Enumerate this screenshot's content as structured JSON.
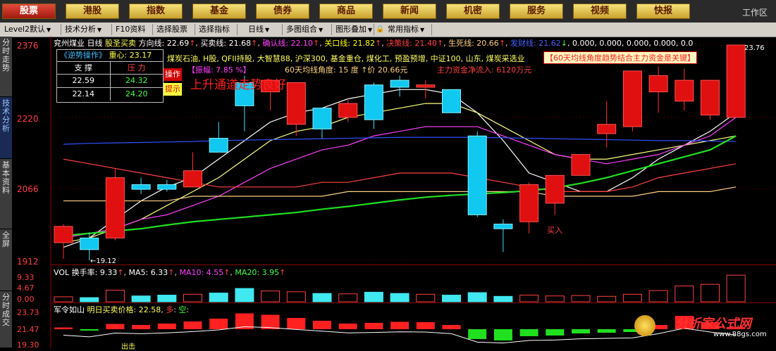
{
  "nav": {
    "buttons": [
      "股票",
      "港股",
      "指数",
      "基金",
      "债券",
      "商品",
      "新闻",
      "机密",
      "服务",
      "视频",
      "快报"
    ],
    "workzone": "工作区"
  },
  "toolbar": {
    "items": [
      "Level2默认",
      "技术分析",
      "F10资料",
      "选择股票",
      "选择指标",
      "日线",
      "多图组合",
      "图形叠加",
      "常用指标"
    ]
  },
  "sidebar": {
    "tabs": [
      "分时走势",
      "技术分析",
      "基本资料",
      "全屏",
      "分时成交"
    ]
  },
  "chart_header": {
    "stock_name": "兖州煤业",
    "period": "日线",
    "indicator": "股圣买卖",
    "lines": [
      {
        "label": "方向线: 22.69",
        "arrow": "↑",
        "color": "#ffffff"
      },
      {
        "label": "买卖线: 21.68",
        "arrow": "↑",
        "color": "#ffffff"
      },
      {
        "label": "确认线: 22.10",
        "arrow": "↑",
        "color": "#ff40ff"
      },
      {
        "label": "关口线: 21.82",
        "arrow": "↑",
        "color": "#ffff00"
      },
      {
        "label": "决策线: 21.40",
        "arrow": "↑",
        "color": "#ff4040"
      },
      {
        "label": "生死线: 20.66",
        "arrow": "↑",
        "color": "#ffd080"
      },
      {
        "label": "发财线: 21.62",
        "arrow": "↓",
        "color": "#4060ff"
      }
    ],
    "extra_values": "0.000, 0.000, 0.000, 0.000, 0.0"
  },
  "reversal_table": {
    "title": "《逆势操作》",
    "center_label": "重心: 23.17",
    "headers": [
      "支 撑",
      "压 力"
    ],
    "rows": [
      [
        "22.59",
        "24.32"
      ],
      [
        "22.14",
        "24.20"
      ]
    ]
  },
  "concepts": "煤炭石油, H股, QFII持股, 大智慧88, 沪深300, 基金重仓, 煤化工, 预盈预增, 中证100, 山东, 煤炭采选业",
  "amplitude": "【振幅: 7.85 %】",
  "ma_angle": "60天均线角度: 15 度 ↑价 20.66元",
  "main_fund": "主力资金净流入: 6120万元",
  "notice": "【60天均线角度趋势结合主力资金是关键】",
  "op_button": "操作",
  "tip_button": "提示",
  "trend_comment": "上升通道走势良好",
  "y_labels": [
    "2376",
    "2220",
    "2066",
    "1912"
  ],
  "low_label": "←19.12",
  "high_label": "23.76",
  "buy_label": "买入",
  "vol": {
    "name": "VOL",
    "turnover": "换手率: 9.33",
    "ma5": "MA5: 6.33",
    "ma10": "MA10: 4.55",
    "ma20": "MA20: 3.95",
    "y_labels": [
      "9.33",
      "4.67",
      "0.00"
    ]
  },
  "army": {
    "title": "军令如山",
    "next_price": "明日买卖价格: 22.58",
    "long_label": "多",
    "short_label": "空",
    "y_labels": [
      "23.73",
      "21.47",
      "19.30"
    ],
    "sell_label": "出击"
  },
  "watermark": "分析家公式网",
  "watermark_url": "www.88gs.com",
  "chart_data": {
    "type": "candlestick",
    "title": "兖州煤业 日线",
    "price_range": [
      19.12,
      23.76
    ],
    "candles": [
      {
        "o": 19.5,
        "h": 19.9,
        "l": 19.15,
        "c": 19.85
      },
      {
        "o": 19.6,
        "h": 19.72,
        "l": 19.12,
        "c": 19.35
      },
      {
        "o": 19.6,
        "h": 21.1,
        "l": 19.55,
        "c": 20.9
      },
      {
        "o": 20.75,
        "h": 20.9,
        "l": 20.55,
        "c": 20.65
      },
      {
        "o": 20.75,
        "h": 20.85,
        "l": 20.6,
        "c": 20.65
      },
      {
        "o": 20.7,
        "h": 21.45,
        "l": 20.7,
        "c": 21.05
      },
      {
        "o": 21.75,
        "h": 22.1,
        "l": 21.55,
        "c": 21.45
      },
      {
        "o": 22.95,
        "h": 23.1,
        "l": 21.9,
        "c": 22.45
      },
      {
        "o": 22.75,
        "h": 23.0,
        "l": 22.35,
        "c": 23.0
      },
      {
        "o": 22.05,
        "h": 22.6,
        "l": 21.8,
        "c": 22.95
      },
      {
        "o": 22.4,
        "h": 22.4,
        "l": 21.75,
        "c": 21.95
      },
      {
        "o": 22.2,
        "h": 22.6,
        "l": 22.1,
        "c": 22.5
      },
      {
        "o": 22.9,
        "h": 22.95,
        "l": 21.95,
        "c": 22.15
      },
      {
        "o": 23.0,
        "h": 23.1,
        "l": 22.65,
        "c": 22.85
      },
      {
        "o": 22.85,
        "h": 23.0,
        "l": 22.6,
        "c": 22.9
      },
      {
        "o": 22.8,
        "h": 22.8,
        "l": 22.35,
        "c": 22.3
      },
      {
        "o": 21.8,
        "h": 21.9,
        "l": 20.05,
        "c": 20.1
      },
      {
        "o": 19.9,
        "h": 20.0,
        "l": 19.3,
        "c": 19.8
      },
      {
        "o": 19.95,
        "h": 20.8,
        "l": 19.7,
        "c": 20.75
      },
      {
        "o": 20.35,
        "h": 20.9,
        "l": 20.1,
        "c": 20.95
      },
      {
        "o": 20.95,
        "h": 21.35,
        "l": 20.95,
        "c": 21.4
      },
      {
        "o": 21.85,
        "h": 22.55,
        "l": 21.55,
        "c": 22.05
      },
      {
        "o": 22.0,
        "h": 23.0,
        "l": 21.9,
        "c": 23.2
      },
      {
        "o": 22.75,
        "h": 23.3,
        "l": 22.3,
        "c": 23.1
      },
      {
        "o": 22.55,
        "h": 23.25,
        "l": 22.35,
        "c": 23.0
      },
      {
        "o": 22.25,
        "h": 22.95,
        "l": 22.15,
        "c": 23.0
      },
      {
        "o": 22.2,
        "h": 23.76,
        "l": 22.2,
        "c": 23.76
      }
    ],
    "ma_lines": [
      {
        "name": "方向线",
        "color": "#ffffff",
        "values": [
          19.4,
          19.6,
          20.0,
          20.4,
          20.7,
          20.9,
          21.3,
          21.7,
          22.1,
          22.3,
          22.4,
          22.6,
          22.7,
          22.8,
          22.8,
          22.7,
          22.3,
          21.7,
          21.0,
          20.8,
          20.6,
          20.6,
          20.9,
          21.3,
          21.6,
          21.9,
          22.3
        ]
      },
      {
        "name": "买卖线",
        "color": "#ffff80",
        "values": [
          19.5,
          19.6,
          19.8,
          20.0,
          20.3,
          20.6,
          20.9,
          21.3,
          21.7,
          21.9,
          22.0,
          22.2,
          22.3,
          22.4,
          22.5,
          22.5,
          22.3,
          22.0,
          21.7,
          21.4,
          21.3,
          21.3,
          21.4,
          21.5,
          21.6,
          21.7,
          21.8
        ]
      },
      {
        "name": "确认线",
        "color": "#ff40ff",
        "values": [
          19.6,
          19.7,
          19.8,
          20.0,
          20.1,
          20.3,
          20.5,
          20.8,
          21.1,
          21.3,
          21.5,
          21.6,
          21.8,
          21.9,
          22.0,
          22.0,
          22.0,
          21.8,
          21.6,
          21.4,
          21.3,
          21.2,
          21.3,
          21.4,
          21.6,
          21.8,
          22.2
        ]
      },
      {
        "name": "决策线",
        "color": "#ff4040",
        "values": [
          21.3,
          21.2,
          21.1,
          21.0,
          20.9,
          20.8,
          20.7,
          20.7,
          20.7,
          20.7,
          20.8,
          20.8,
          20.9,
          21.0,
          21.0,
          21.0,
          20.9,
          20.8,
          20.7,
          20.6,
          20.6,
          20.6,
          20.7,
          20.9,
          21.0,
          21.1,
          21.2
        ]
      },
      {
        "name": "生死线",
        "color": "#ffd080",
        "values": [
          20.4,
          20.4,
          20.4,
          20.4,
          20.4,
          20.5,
          20.5,
          20.5,
          20.5,
          20.5,
          20.5,
          20.6,
          20.6,
          20.6,
          20.6,
          20.6,
          20.6,
          20.6,
          20.6,
          20.5,
          20.5,
          20.5,
          20.5,
          20.6,
          20.6,
          20.6,
          20.7
        ]
      },
      {
        "name": "发财线",
        "color": "#3050ff",
        "values": [
          21.62,
          21.64,
          21.65,
          21.66,
          21.67,
          21.68,
          21.7,
          21.71,
          21.72,
          21.73,
          21.74,
          21.75,
          21.76,
          21.77,
          21.77,
          21.77,
          21.77,
          21.76,
          21.75,
          21.74,
          21.73,
          21.72,
          21.71,
          21.7,
          21.7,
          21.69,
          21.68
        ]
      },
      {
        "name": "关口线",
        "color": "#20e020",
        "values": [
          19.65,
          19.7,
          19.75,
          19.8,
          19.88,
          19.95,
          20.0,
          20.05,
          20.1,
          20.15,
          20.22,
          20.28,
          20.35,
          20.42,
          20.48,
          20.52,
          20.55,
          20.58,
          20.62,
          20.68,
          20.78,
          20.9,
          21.05,
          21.2,
          21.35,
          21.5,
          21.8
        ]
      }
    ],
    "volume": [
      1.2,
      1.0,
      2.8,
      1.4,
      1.6,
      1.8,
      2.1,
      3.2,
      2.6,
      2.4,
      2.0,
      1.9,
      2.3,
      2.0,
      1.8,
      1.6,
      2.2,
      1.3,
      1.6,
      1.4,
      1.5,
      1.3,
      1.8,
      2.7,
      3.8,
      4.2,
      6.4
    ],
    "army_values": [
      0.5,
      -0.3,
      1.5,
      1.2,
      1.6,
      2.2,
      3.0,
      4.5,
      4.1,
      3.2,
      2.4,
      1.6,
      1.8,
      2.1,
      2.0,
      1.2,
      -2.8,
      -3.2,
      -2.0,
      -1.8,
      -1.2,
      -1.0,
      -0.8,
      1.2,
      3.8,
      2.0,
      0.6
    ]
  }
}
